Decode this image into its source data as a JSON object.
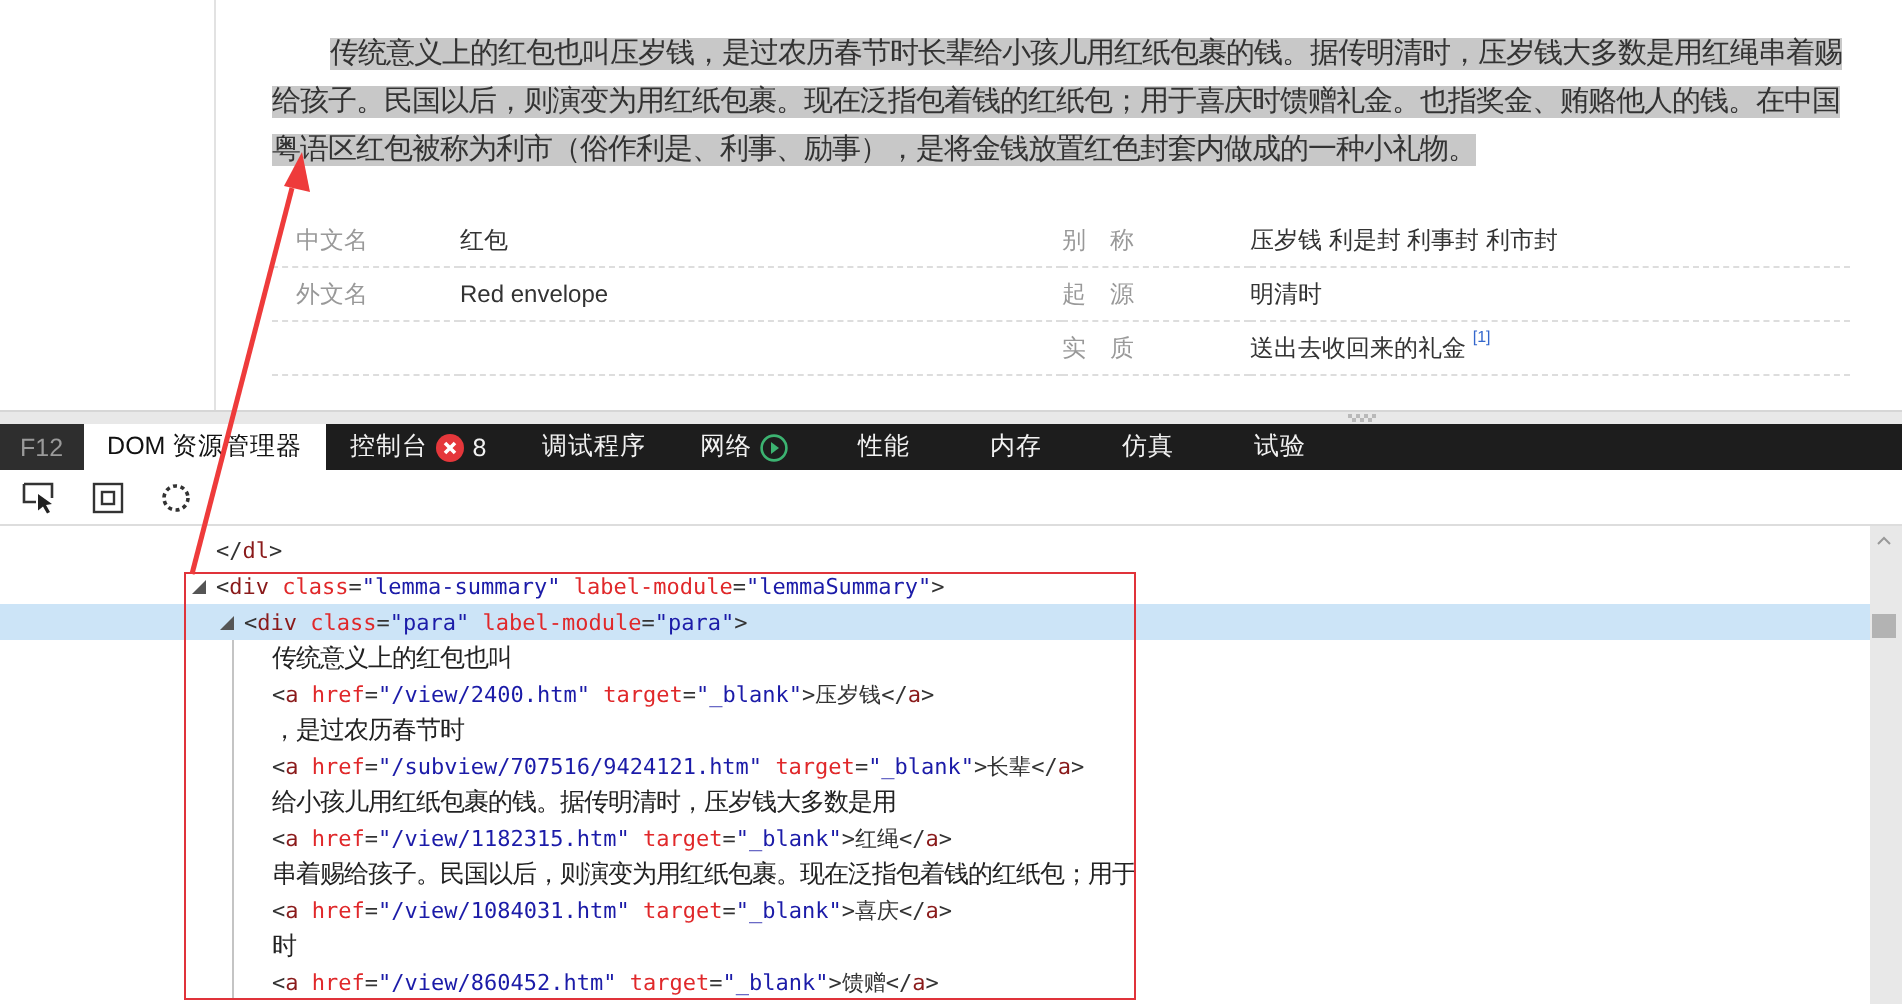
{
  "article": {
    "paragraph": "传统意义上的红包也叫压岁钱，是过农历春节时长辈给小孩儿用红纸包裹的钱。据传明清时，压岁钱大多数是用红绳串着赐给孩子。民国以后，则演变为用红纸包裹。现在泛指包着钱的红纸包；用于喜庆时馈赠礼金。也指奖金、贿赂他人的钱。在中国粤语区红包被称为利市（俗作利是、利事、励事），是将金钱放置红色封套内做成的一种小礼物。",
    "facts": [
      {
        "left_label": "中文名",
        "left_value": "红包",
        "right_label": "别　称",
        "right_value": "压岁钱 利是封 利事封 利市封"
      },
      {
        "left_label": "外文名",
        "left_value": "Red envelope",
        "right_label": "起　源",
        "right_value": "明清时"
      },
      {
        "right_label": "实　质",
        "right_value": "送出去收回来的礼金 $^{[1]}$"
      }
    ]
  },
  "devtools": {
    "tabs": [
      {
        "label": "F12",
        "kind": "key"
      },
      {
        "label": "DOM 资源管理器",
        "kind": "tab",
        "selected": true
      },
      {
        "label": "控制台",
        "kind": "tab",
        "selected": false,
        "badge": "8"
      },
      {
        "label": "调试程序",
        "kind": "tab",
        "selected": false
      },
      {
        "label": "网络",
        "kind": "tab",
        "selected": false,
        "playing": true
      },
      {
        "label": "性能",
        "kind": "tab",
        "selected": false
      },
      {
        "label": "内存",
        "kind": "tab",
        "selected": false
      },
      {
        "label": "仿真",
        "kind": "tab",
        "selected": false
      },
      {
        "label": "试验",
        "kind": "tab",
        "selected": false
      }
    ],
    "dom_tree": [
      {
        "kind": "markup",
        "code": "</dl>",
        "selected": false
      },
      {
        "kind": "markup",
        "code": "<div class=\"lemma-summary\" label-module=\"lemmaSummary\">",
        "expanded": true,
        "selected": false,
        "children": [
          {
            "kind": "markup",
            "code": "<div class=\"para\" label-module=\"para\">",
            "expanded": true,
            "selected": true,
            "children": [
              {
                "kind": "text",
                "code": "传统意义上的红包也叫",
                "selected": false
              },
              {
                "kind": "markup",
                "code": "<a href=\"/view/2400.htm\" target=\"_blank\">压岁钱</a>",
                "selected": false
              },
              {
                "kind": "text",
                "code": "，是过农历春节时",
                "selected": false
              },
              {
                "kind": "markup",
                "code": "<a href=\"/subview/707516/9424121.htm\" target=\"_blank\">长辈</a>",
                "selected": false
              },
              {
                "kind": "text",
                "code": "给小孩儿用红纸包裹的钱。据传明清时，压岁钱大多数是用",
                "selected": false
              },
              {
                "kind": "markup",
                "code": "<a href=\"/view/1182315.htm\" target=\"_blank\">红绳</a>",
                "selected": false
              },
              {
                "kind": "text",
                "code": "串着赐给孩子。民国以后，则演变为用红纸包裹。现在泛指包着钱的红纸包；用于",
                "selected": false
              },
              {
                "kind": "markup",
                "code": "<a href=\"/view/1084031.htm\" target=\"_blank\">喜庆</a>",
                "selected": false
              },
              {
                "kind": "text",
                "code": "时",
                "selected": false
              },
              {
                "kind": "markup",
                "code": "<a href=\"/view/860452.htm\" target=\"_blank\">馈赠</a>",
                "selected": false
              }
            ]
          }
        ]
      }
    ]
  }
}
